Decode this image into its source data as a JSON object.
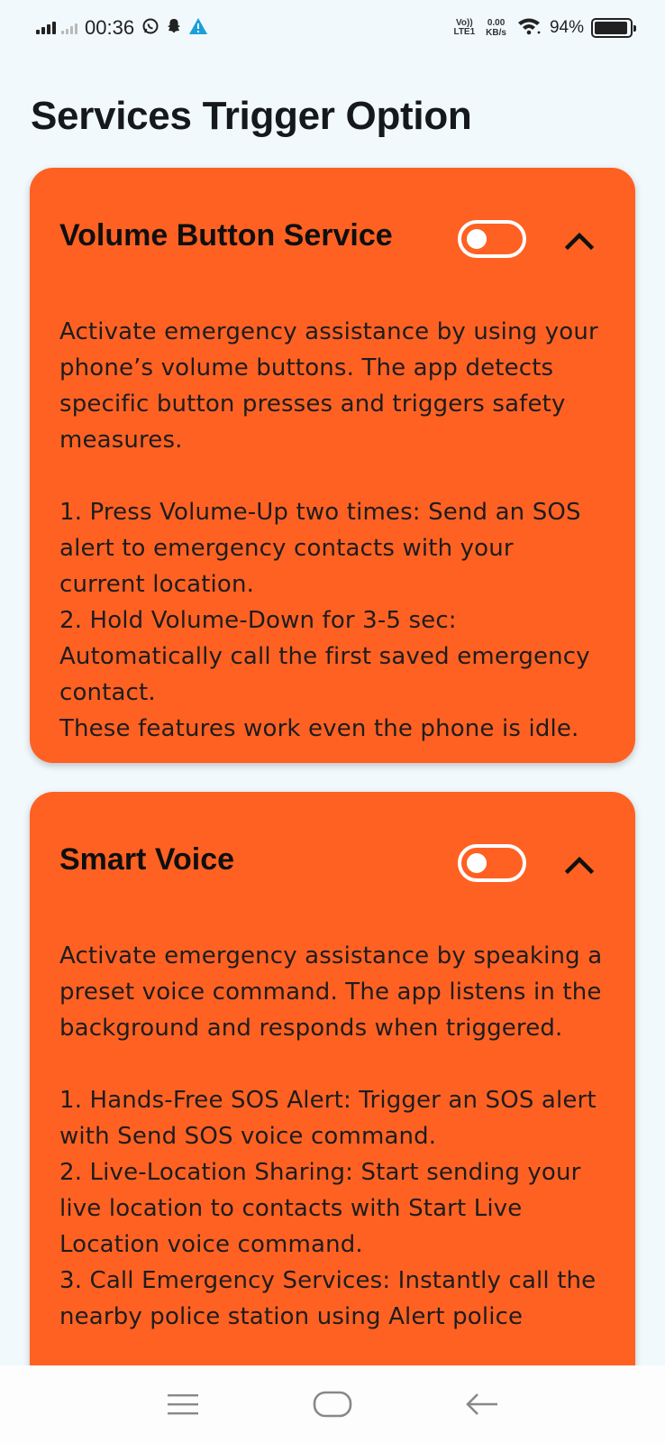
{
  "status_bar": {
    "time": "00:36",
    "volte_top": "Vo))",
    "volte_bottom": "LTE1",
    "speed_value": "0.00",
    "speed_unit": "KB/s",
    "battery_percent": "94%",
    "battery_level": 0.94,
    "icons": [
      "signal-icon",
      "signal-secondary-icon",
      "whatsapp-icon",
      "snapchat-icon",
      "warning-icon",
      "wifi-icon",
      "battery-icon"
    ]
  },
  "page": {
    "title": "Services Trigger Option"
  },
  "cards": [
    {
      "title": "Volume Button Service",
      "enabled": false,
      "expanded": true,
      "intro": "Activate emergency assistance by using your phone’s volume buttons. The app detects specific button presses and triggers safety measures.",
      "lines": [
        "1. Press Volume-Up two times: Send an SOS alert to emergency contacts with your current location.",
        "2. Hold Volume-Down for 3-5 sec: Automatically call the first saved emergency contact.",
        "These features work even the phone is idle."
      ]
    },
    {
      "title": "Smart Voice",
      "enabled": false,
      "expanded": true,
      "intro": "Activate emergency assistance by speaking a preset voice command. The app listens in the background and responds when triggered.",
      "lines": [
        "1. Hands-Free SOS Alert: Trigger an SOS alert with Send SOS voice command.",
        "2. Live-Location Sharing: Start sending your live location to contacts with Start Live Location voice command.",
        "3. Call Emergency Services: Instantly call the nearby police station using Alert police"
      ]
    }
  ],
  "nav_bar": {
    "buttons": [
      "menu-icon",
      "home-icon",
      "back-icon"
    ]
  },
  "colors": {
    "card": "#ff6123",
    "background": "#f1f9fd",
    "title": "#16191c"
  }
}
